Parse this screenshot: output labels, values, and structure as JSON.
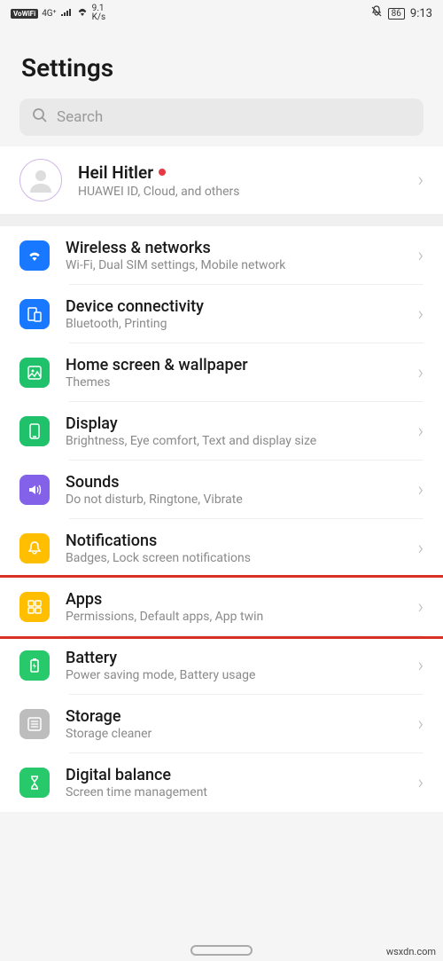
{
  "status": {
    "vowifi": "VoWiFi",
    "netgen": "4G⁺",
    "speed_top": "9.1",
    "speed_bottom": "K/s",
    "battery": "86",
    "time": "9:13"
  },
  "header": {
    "title": "Settings"
  },
  "search": {
    "placeholder": "Search"
  },
  "account": {
    "name": "Heil Hitler",
    "sub": "HUAWEI ID, Cloud, and others"
  },
  "items": [
    {
      "id": "wireless",
      "title": "Wireless & networks",
      "sub": "Wi-Fi, Dual SIM settings, Mobile network",
      "icon": "wifi-icon",
      "color": "c-blue"
    },
    {
      "id": "device-connectivity",
      "title": "Device connectivity",
      "sub": "Bluetooth, Printing",
      "icon": "device-icon",
      "color": "c-blue"
    },
    {
      "id": "home-screen",
      "title": "Home screen & wallpaper",
      "sub": "Themes",
      "icon": "image-icon",
      "color": "c-green"
    },
    {
      "id": "display",
      "title": "Display",
      "sub": "Brightness, Eye comfort, Text and display size",
      "icon": "display-icon",
      "color": "c-green"
    },
    {
      "id": "sounds",
      "title": "Sounds",
      "sub": "Do not disturb, Ringtone, Vibrate",
      "icon": "sound-icon",
      "color": "c-purple"
    },
    {
      "id": "notifications",
      "title": "Notifications",
      "sub": "Badges, Lock screen notifications",
      "icon": "bell-icon",
      "color": "c-yellow"
    },
    {
      "id": "apps",
      "title": "Apps",
      "sub": "Permissions, Default apps, App twin",
      "icon": "apps-icon",
      "color": "c-yellow",
      "highlight": true
    },
    {
      "id": "battery",
      "title": "Battery",
      "sub": "Power saving mode, Battery usage",
      "icon": "battery-icon",
      "color": "c-green2"
    },
    {
      "id": "storage",
      "title": "Storage",
      "sub": "Storage cleaner",
      "icon": "storage-icon",
      "color": "c-gray"
    },
    {
      "id": "digital-balance",
      "title": "Digital balance",
      "sub": "Screen time management",
      "icon": "hourglass-icon",
      "color": "c-green2"
    }
  ],
  "watermark": "wsxdn.com"
}
